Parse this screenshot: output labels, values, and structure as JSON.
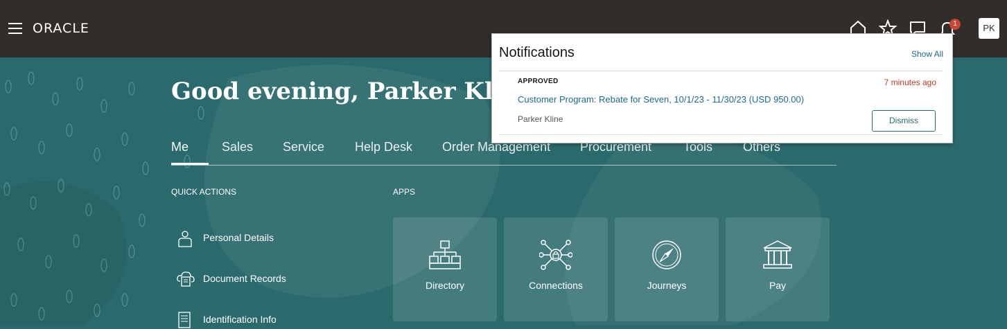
{
  "header": {
    "logo_text": "ORACLE",
    "badge_count": "1",
    "avatar_initials": "PK"
  },
  "greeting": "Good evening, Parker Kline",
  "tabs": [
    {
      "label": "Me"
    },
    {
      "label": "Sales"
    },
    {
      "label": "Service"
    },
    {
      "label": "Help Desk"
    },
    {
      "label": "Order Management"
    },
    {
      "label": "Procurement"
    },
    {
      "label": "Tools"
    },
    {
      "label": "Others"
    }
  ],
  "quick_actions": {
    "title": "QUICK ACTIONS",
    "items": [
      {
        "label": "Personal Details",
        "icon": "person-icon"
      },
      {
        "label": "Document Records",
        "icon": "document-cloud-icon"
      },
      {
        "label": "Identification Info",
        "icon": "id-document-icon"
      }
    ]
  },
  "apps": {
    "title": "APPS",
    "items": [
      {
        "label": "Directory",
        "icon": "org-chart-icon"
      },
      {
        "label": "Connections",
        "icon": "network-icon"
      },
      {
        "label": "Journeys",
        "icon": "compass-icon"
      },
      {
        "label": "Pay",
        "icon": "bank-icon"
      }
    ]
  },
  "notifications": {
    "title": "Notifications",
    "show_all": "Show All",
    "items": [
      {
        "status": "APPROVED",
        "time": "7 minutes ago",
        "link": "Customer Program: Rebate for Seven, 10/1/23 - 11/30/23 (USD 950.00)",
        "person": "Parker Kline",
        "dismiss": "Dismiss"
      }
    ]
  },
  "colors": {
    "header_bg": "#312d2a",
    "hero_bg": "#2b6a6c",
    "badge": "#c74634",
    "link": "#1b6b8a"
  }
}
